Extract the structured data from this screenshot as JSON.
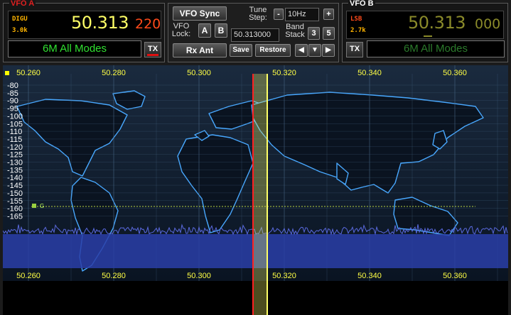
{
  "vfo_a": {
    "title": "VFO A",
    "mode": "DIGU",
    "bandwidth": "3.0k",
    "freq_main": "50.313",
    "freq_sub": "220",
    "band_label": "6M All Modes",
    "tx_label": "TX",
    "colors": {
      "title": "#e02020",
      "freq_main": "#ffff66",
      "freq_sub": "#ff4a1a",
      "band": "#30e030"
    }
  },
  "vfo_b": {
    "title": "VFO B",
    "mode": "LSB",
    "bandwidth": "2.7k",
    "freq_main": "50.313",
    "freq_sub": "000",
    "band_label": "6M All Modes",
    "tx_label": "TX",
    "colors": {
      "title": "#ffffff",
      "freq_main": "#8a8a2a",
      "freq_sub": "#8a8a2a",
      "band": "#2b7a2b"
    }
  },
  "controls": {
    "vfo_sync": "VFO Sync",
    "tune_step_label": [
      "Tune",
      "Step:"
    ],
    "tune_step_value": "10Hz",
    "minus": "-",
    "plus": "+",
    "vfo_lock_label": [
      "VFO",
      "Lock:"
    ],
    "lock_a": "A",
    "lock_b": "B",
    "freq_entry": "50.313000",
    "band_stack_label": [
      "Band",
      "Stack"
    ],
    "stack_3": "3",
    "stack_5": "5",
    "rx_ant": "Rx Ant",
    "save": "Save",
    "restore": "Restore",
    "arrow_left": "◀",
    "arrow_down": "▼",
    "arrow_right": "▶"
  },
  "panadapter": {
    "freq_ticks": [
      "50.260",
      "50.280",
      "50.300",
      "50.320",
      "50.340",
      "50.360"
    ],
    "db_ticks": [
      "-80",
      "-85",
      "-90",
      "-95",
      "-100",
      "-105",
      "-110",
      "-115",
      "-120",
      "-125",
      "-130",
      "-135",
      "-140",
      "-145",
      "-150",
      "-155",
      "-160",
      "-165"
    ],
    "squelch_marker": "G",
    "colors": {
      "tick_text": "#ffff44",
      "db_text": "#ffffff",
      "grid": "#4a6a8a",
      "filter": "#ffff66",
      "vfo_line": "#ff2020",
      "noise": "#3a4cc8",
      "map": "#48a8ff"
    }
  }
}
